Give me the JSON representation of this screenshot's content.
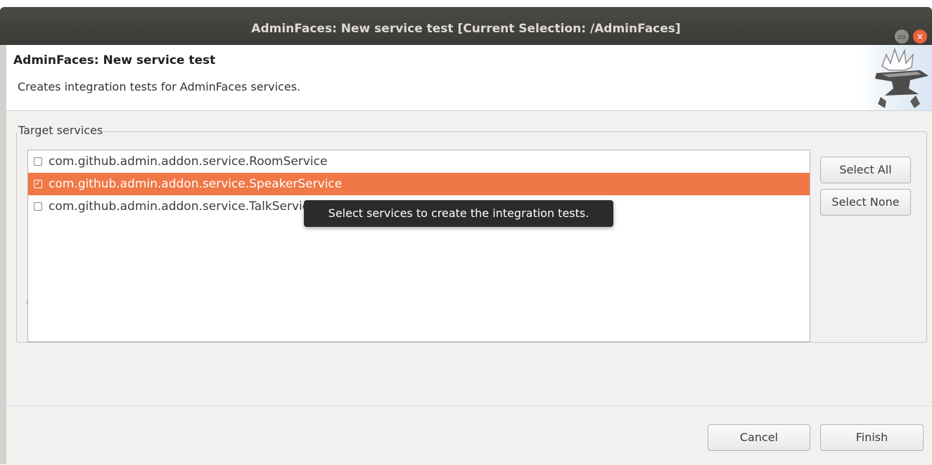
{
  "window": {
    "title": "AdminFaces: New service test [Current Selection: /AdminFaces]",
    "buttons": {
      "maximize_icon": "maximize-icon",
      "close_icon": "close-icon",
      "close_glyph": "×"
    }
  },
  "banner": {
    "title": "AdminFaces: New service test",
    "description": "Creates integration tests for AdminFaces services.",
    "image_icon": "anvil-icon"
  },
  "target_services": {
    "legend": "Target services",
    "required_marker": "*",
    "items": [
      {
        "label": "com.github.admin.addon.service.RoomService",
        "checked": false,
        "selected": false
      },
      {
        "label": "com.github.admin.addon.service.SpeakerService",
        "checked": true,
        "selected": true
      },
      {
        "label": "com.github.admin.addon.service.TalkService",
        "checked": false,
        "selected": false
      }
    ],
    "select_all_label": "Select All",
    "select_none_label": "Select None"
  },
  "tooltip": {
    "text": "Select services to create the integration tests."
  },
  "footer": {
    "cancel_label": "Cancel",
    "finish_label": "Finish"
  },
  "colors": {
    "selection": "#f07746",
    "titlebar": "#3c3b37",
    "dialog_bg": "#f2f1f0"
  }
}
